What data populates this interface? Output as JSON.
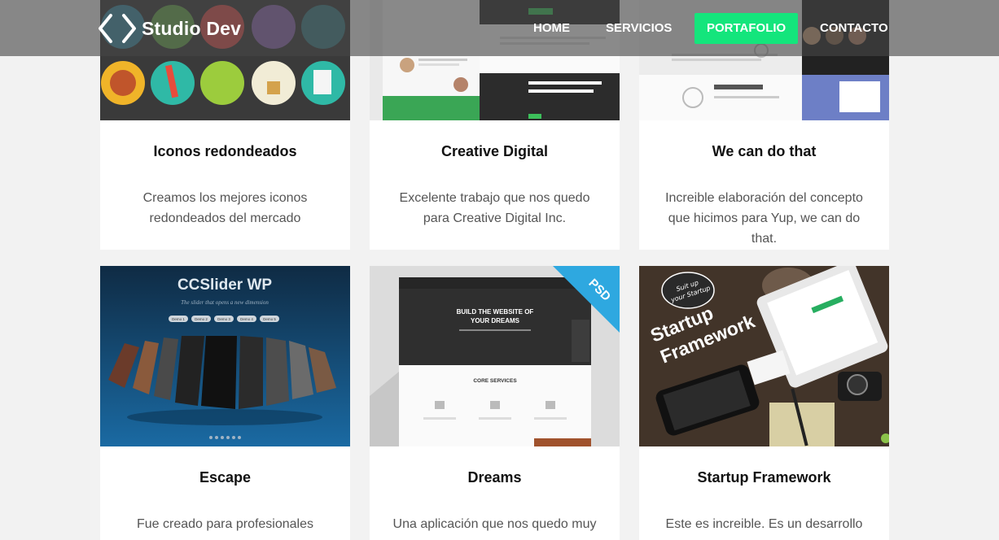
{
  "brand": {
    "name": "Studio Dev",
    "logo_icon": "code-brackets-icon"
  },
  "nav": {
    "items": [
      {
        "label": "HOME"
      },
      {
        "label": "SERVICIOS"
      },
      {
        "label": "PORTAFOLIO",
        "active": true
      },
      {
        "label": "CONTACTO"
      }
    ]
  },
  "colors": {
    "accent": "#14e57c",
    "navbar": "rgba(70,70,70,0.62)",
    "background": "#f2f2f2"
  },
  "portfolio": [
    {
      "title": "Iconos redondeados",
      "description": "Creamos los mejores iconos redondeados del mercado"
    },
    {
      "title": "Creative Digital",
      "description": "Excelente trabajo que nos quedo para Creative Digital Inc."
    },
    {
      "title": "We can do that",
      "description": "Increible elaboración del concepto que hicimos para Yup, we can do that."
    },
    {
      "title": "Escape",
      "description": "Fue creado para profesionales",
      "thumb_text": {
        "title": "CCSlider WP",
        "tagline": "The slider that opens a new dimension",
        "demos": [
          "Demo 1",
          "Demo 2",
          "Demo 3",
          "Demo 4",
          "Demo 5"
        ]
      }
    },
    {
      "title": "Dreams",
      "description": "Una aplicación que nos quedo muy",
      "thumb_text": {
        "ribbon": "PSD",
        "headline1": "BUILD THE WEBSITE OF",
        "headline2": "YOUR DREAMS",
        "section": "CORE SERVICES"
      }
    },
    {
      "title": "Startup Framework",
      "description": "Este es increible. Es un desarrollo que",
      "thumb_text": {
        "sticker1": "Suit up",
        "sticker2": "your Startup",
        "line1": "Startup",
        "line2": "Framework"
      }
    }
  ]
}
